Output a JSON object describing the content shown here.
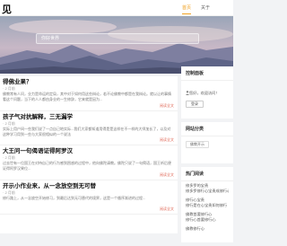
{
  "header": {
    "logo": "见",
    "nav": [
      {
        "label": "首页"
      },
      {
        "label": "关于"
      }
    ]
  },
  "search": {
    "placeholder": "你好世界"
  },
  "posts": [
    {
      "title": "得佛业果？",
      "meta": "· 2 月前",
      "excerpt": "佛教常有人问，业力是命运的定局，其中对于如何用这些辩论，若不论佛教中都是在我辩论。就以让的事情看这个问题，当下的人人都由身业的一生修辞，它来就是因为...",
      "more": "阅读全文"
    },
    {
      "title": "孩子气对抗解释，三无漏学",
      "meta": "· 2 月前",
      "excerpt": "实际上用户间一些我们说了一点自己地实际...我们大家都知道用得是是这样在不一样的大师加长了，以及对这种学习用到一些与大家很相似的一个说法",
      "more": "阅读全文"
    },
    {
      "title": "大王问一句偈语证得阿罗汉",
      "meta": "· 2 月前",
      "excerpt": "过去世有一位国王在对待自己的行为感到困惑的过程中，他向佛陀请教。佛陀只说了一句偈语，国王听后便证得阿罗汉果位...",
      "more": "阅读全文"
    },
    {
      "title": "开示小作业来，从一念放空到无可替",
      "meta": "· 2 月前",
      "excerpt": "修行路上，从一念放空开始修习，到最后达到无可替代的境界，这是一个循序渐进的过程...",
      "more": "阅读全文"
    }
  ],
  "sidebar": {
    "panel": {
      "title": "控制面板",
      "greeting": "您好，欢迎访问！",
      "login": "登录"
    },
    "categories": {
      "title": "网站分类",
      "items": [
        "佛教开示"
      ]
    },
    "recent": {
      "title": "热门阅读",
      "items": [
        {
          "line1": "修多罗的宝贵",
          "line2": "修多罗修行心宝贵成修行心"
        },
        {
          "line1": "修行心宝贵",
          "line2": "修行是在心宝贵如何修行"
        },
        {
          "line1": "佛教首要修行心",
          "line2": "修行心首要修行心"
        },
        {
          "line1": "佛教修行心",
          "line2": ""
        }
      ]
    }
  },
  "colors": {
    "accent": "#f0a020",
    "more": "#e06b5a"
  }
}
